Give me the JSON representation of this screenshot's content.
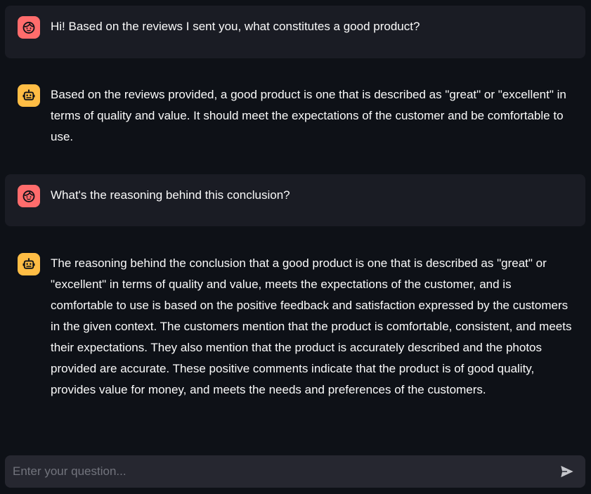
{
  "messages": [
    {
      "role": "user",
      "avatar_icon": "face-icon",
      "text": "Hi! Based on the reviews I sent you, what constitutes a good product?"
    },
    {
      "role": "assistant",
      "avatar_icon": "robot-icon",
      "text": "Based on the reviews provided, a good product is one that is described as \"great\" or \"excellent\" in terms of quality and value. It should meet the expectations of the customer and be comfortable to use."
    },
    {
      "role": "user",
      "avatar_icon": "face-icon",
      "text": "What's the reasoning behind this conclusion?"
    },
    {
      "role": "assistant",
      "avatar_icon": "robot-icon",
      "text": "The reasoning behind the conclusion that a good product is one that is described as \"great\" or \"excellent\" in terms of quality and value, meets the expectations of the customer, and is comfortable to use is based on the positive feedback and satisfaction expressed by the customers in the given context. The customers mention that the product is comfortable, consistent, and meets their expectations. They also mention that the product is accurately described and the photos provided are accurate. These positive comments indicate that the product is of good quality, provides value for money, and meets the needs and preferences of the customers."
    }
  ],
  "input": {
    "placeholder": "Enter your question...",
    "value": ""
  },
  "colors": {
    "background": "#0e1117",
    "user_message_bg": "#1a1c24",
    "user_avatar": "#ff6c6c",
    "assistant_avatar": "#ffbd45",
    "input_bg": "#262730",
    "text": "#fafafa"
  }
}
